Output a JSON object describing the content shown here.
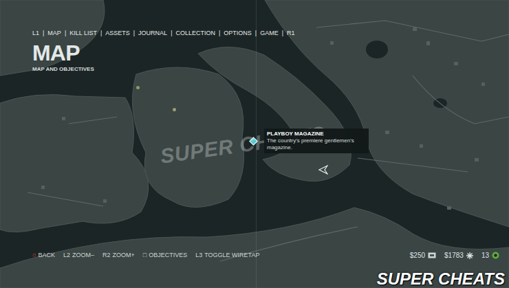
{
  "nav": {
    "separator": "|",
    "items": [
      "L1",
      "MAP",
      "KILL LIST",
      "ASSETS",
      "JOURNAL",
      "COLLECTION",
      "OPTIONS",
      "GAME",
      "R1"
    ]
  },
  "header": {
    "title": "MAP",
    "subtitle": "MAP AND OBJECTIVES"
  },
  "tooltip": {
    "title": "PLAYBOY MAGAZINE",
    "description": "The country's premiere gentlemen's magazine."
  },
  "controls": [
    {
      "button": "○",
      "label": "BACK",
      "color": "#e0463c"
    },
    {
      "button": "L2",
      "label": "ZOOM–",
      "color": "#cfd5d4"
    },
    {
      "button": "R2",
      "label": "ZOOM+",
      "color": "#cfd5d4"
    },
    {
      "button": "□",
      "label": "OBJECTIVES",
      "color": "#cfd5d4"
    },
    {
      "button": "L3",
      "label": "TOGGLE WIRETAP",
      "color": "#cfd5d4"
    }
  ],
  "currency": [
    {
      "value": "$250",
      "kind": "cash"
    },
    {
      "value": "$1783",
      "kind": "bank"
    },
    {
      "value": "13",
      "kind": "resource"
    }
  ],
  "watermarks": [
    "SUPER CHEATS",
    "SUPER CHEATS"
  ]
}
